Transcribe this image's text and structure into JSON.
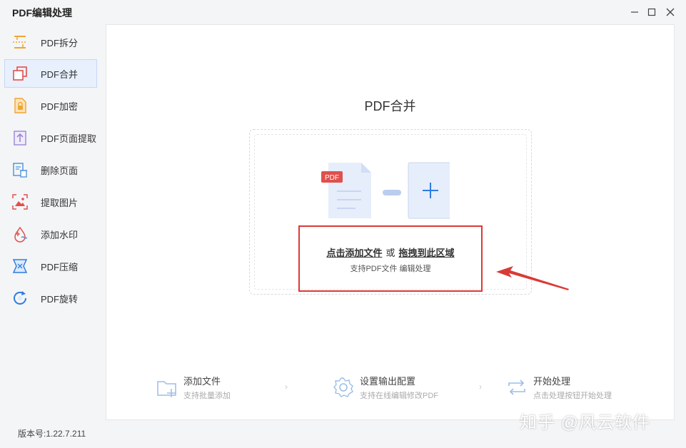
{
  "app": {
    "title": "PDF编辑处理",
    "version": "版本号:1.22.7.211"
  },
  "sidebar": {
    "items": [
      {
        "label": "PDF拆分",
        "icon": "split-icon"
      },
      {
        "label": "PDF合并",
        "icon": "merge-icon",
        "active": true
      },
      {
        "label": "PDF加密",
        "icon": "lock-icon"
      },
      {
        "label": "PDF页面提取",
        "icon": "extract-page-icon"
      },
      {
        "label": "删除页面",
        "icon": "delete-page-icon"
      },
      {
        "label": "提取图片",
        "icon": "extract-image-icon"
      },
      {
        "label": "添加水印",
        "icon": "watermark-icon"
      },
      {
        "label": "PDF压缩",
        "icon": "compress-icon"
      },
      {
        "label": "PDF旋转",
        "icon": "rotate-icon"
      }
    ]
  },
  "main": {
    "title": "PDF合并",
    "dropzone": {
      "badge": "PDF",
      "click_add": "点击添加文件",
      "or": "或",
      "drag_here": "拖拽到此区域",
      "support": "支持PDF文件 编辑处理"
    },
    "steps": [
      {
        "title": "添加文件",
        "desc": "支持批量添加",
        "icon": "add-folder-icon"
      },
      {
        "title": "设置输出配置",
        "desc": "支持在线编辑修改PDF",
        "icon": "gear-icon"
      },
      {
        "title": "开始处理",
        "desc": "点击处理按钮开始处理",
        "icon": "process-icon"
      }
    ]
  },
  "watermark": "知乎 @风云软件",
  "colors": {
    "accent": "#2f7de1",
    "highlight_box": "#d93a36",
    "active_bg": "#e8f0fd"
  }
}
